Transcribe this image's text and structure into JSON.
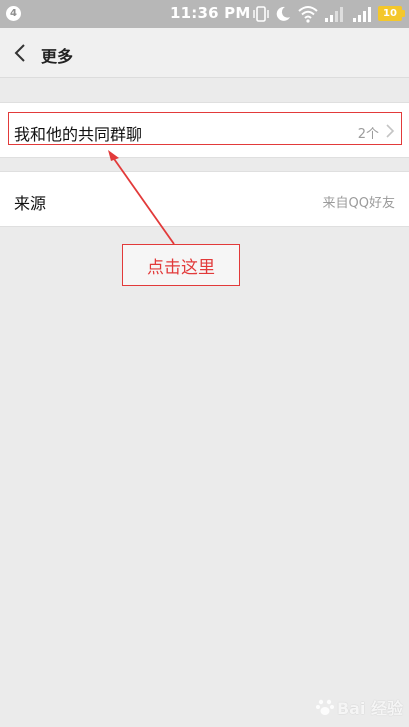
{
  "status_bar": {
    "notification_count": "4",
    "time": "11:36 PM",
    "battery_level": "10",
    "icons": [
      "vibrate-icon",
      "moon-icon",
      "wifi-icon",
      "signal-icon",
      "signal-icon",
      "battery-icon"
    ]
  },
  "header": {
    "title": "更多",
    "back_icon": "chevron-left-icon"
  },
  "rows": [
    {
      "label": "我和他的共同群聊",
      "value": "2个",
      "has_chevron": true
    },
    {
      "label": "来源",
      "value": "来自QQ好友",
      "has_chevron": false
    }
  ],
  "annotation": {
    "callout_text": "点击这里",
    "color": "#e23a3a"
  },
  "watermark": {
    "text": "Bai 经验"
  }
}
